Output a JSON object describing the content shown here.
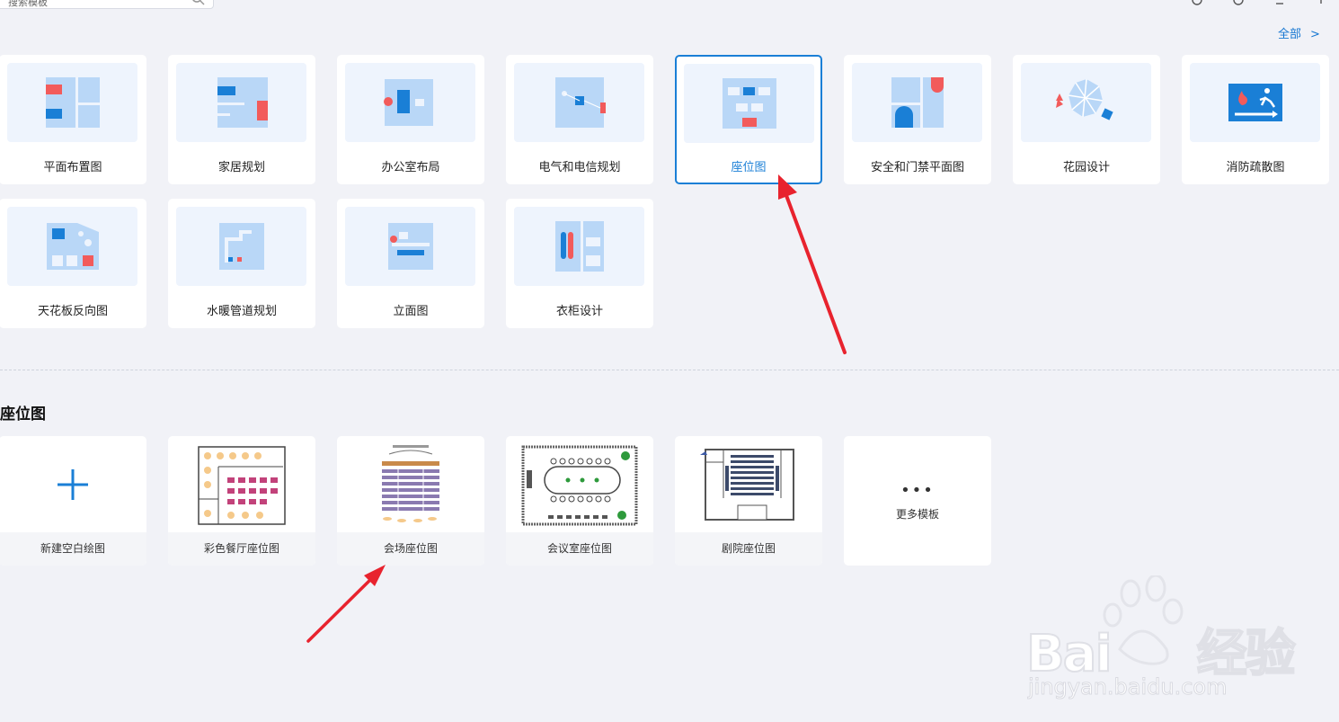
{
  "search": {
    "text": "搜索模板"
  },
  "header": {
    "more_link": "全部",
    "more_chevron": ">"
  },
  "categories": [
    {
      "label": "平面布置图",
      "icon": "floor-plan-icon",
      "selected": false
    },
    {
      "label": "家居规划",
      "icon": "home-plan-icon",
      "selected": false
    },
    {
      "label": "办公室布局",
      "icon": "office-layout-icon",
      "selected": false
    },
    {
      "label": "电气和电信规划",
      "icon": "electrical-plan-icon",
      "selected": false
    },
    {
      "label": "座位图",
      "icon": "seating-chart-icon",
      "selected": true
    },
    {
      "label": "安全和门禁平面图",
      "icon": "security-plan-icon",
      "selected": false
    },
    {
      "label": "花园设计",
      "icon": "garden-design-icon",
      "selected": false
    },
    {
      "label": "消防疏散图",
      "icon": "fire-evacuation-icon",
      "selected": false
    },
    {
      "label": "天花板反向图",
      "icon": "ceiling-plan-icon",
      "selected": false
    },
    {
      "label": "水暖管道规划",
      "icon": "plumbing-plan-icon",
      "selected": false
    },
    {
      "label": "立面图",
      "icon": "elevation-icon",
      "selected": false
    },
    {
      "label": "衣柜设计",
      "icon": "wardrobe-design-icon",
      "selected": false
    }
  ],
  "section": {
    "title": "座位图"
  },
  "templates": [
    {
      "label": "新建空白绘图",
      "icon": "plus-icon"
    },
    {
      "label": "彩色餐厅座位图",
      "icon": "restaurant-seating-thumbnail"
    },
    {
      "label": "会场座位图",
      "icon": "venue-seating-thumbnail"
    },
    {
      "label": "会议室座位图",
      "icon": "meeting-room-thumbnail"
    },
    {
      "label": "剧院座位图",
      "icon": "theater-seating-thumbnail"
    }
  ],
  "more_templates": {
    "dots": "•••",
    "label": "更多模板"
  },
  "watermark": {
    "brand": "Bai",
    "brand_cn": "经验",
    "url": "jingyan.baidu.com"
  },
  "colors": {
    "accent": "#1a7fd6",
    "arrow": "#e8232e",
    "thumb_bg": "#eef4fd",
    "page_bg": "#f1f2f7"
  }
}
